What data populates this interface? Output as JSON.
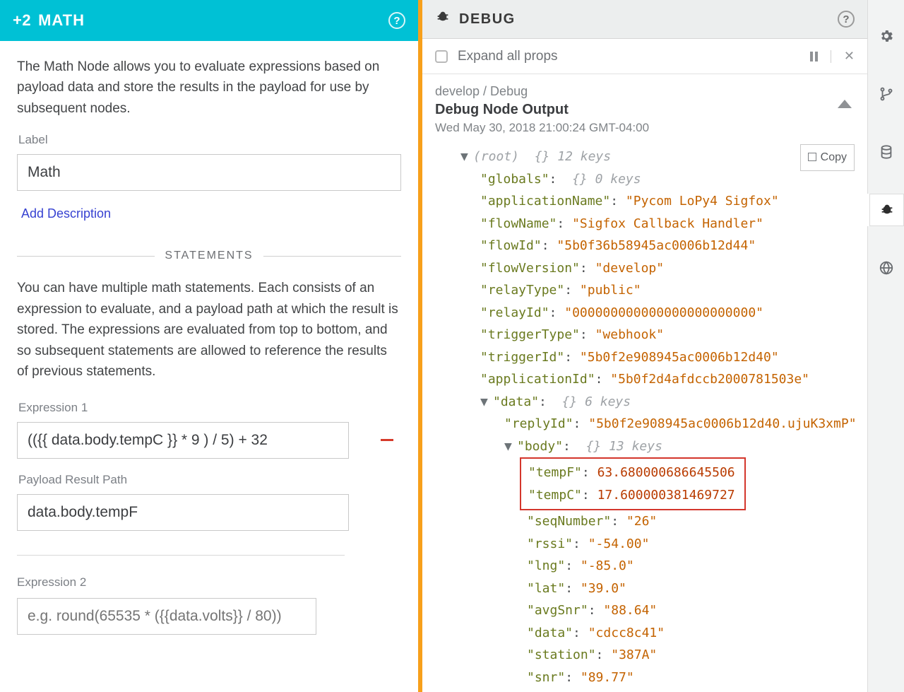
{
  "leftPanel": {
    "header": {
      "badge": "+2",
      "title": "MATH"
    },
    "intro": "The Math Node allows you to evaluate expressions based on payload data and store the results in the payload for use by subsequent nodes.",
    "labelField": {
      "label": "Label",
      "value": "Math"
    },
    "addDescription": "Add Description",
    "statementsHeader": "STATEMENTS",
    "statementsText": "You can have multiple math statements. Each consists of an expression to evaluate, and a payload path at which the result is stored. The expressions are evaluated from top to bottom, and so subsequent statements are allowed to reference the results of previous statements.",
    "expr1": {
      "label": "Expression 1",
      "value": "(({{ data.body.tempC }} * 9 ) / 5) + 32"
    },
    "resultPath": {
      "label": "Payload Result Path",
      "value": "data.body.tempF"
    },
    "expr2": {
      "label": "Expression 2",
      "placeholder": "e.g. round(65535 * ({{data.volts}} / 80))"
    }
  },
  "rightPanel": {
    "headerTitle": "DEBUG",
    "expandAll": "Expand all props",
    "crumbs": "develop / Debug",
    "title": "Debug Node Output",
    "timestamp": "Wed May 30, 2018 21:00:24 GMT-04:00",
    "copyLabel": "Copy",
    "root": {
      "label": "(root)",
      "meta": "{}  12 keys"
    },
    "rows": [
      {
        "key": "globals",
        "metaOnly": true,
        "meta": "{}  0 keys"
      },
      {
        "key": "applicationName",
        "val": "Pycom LoPy4 Sigfox",
        "type": "str"
      },
      {
        "key": "flowName",
        "val": "Sigfox Callback Handler",
        "type": "str"
      },
      {
        "key": "flowId",
        "val": "5b0f36b58945ac0006b12d44",
        "type": "str"
      },
      {
        "key": "flowVersion",
        "val": "develop",
        "type": "str"
      },
      {
        "key": "relayType",
        "val": "public",
        "type": "str"
      },
      {
        "key": "relayId",
        "val": "000000000000000000000000",
        "type": "str"
      },
      {
        "key": "triggerType",
        "val": "webhook",
        "type": "str"
      },
      {
        "key": "triggerId",
        "val": "5b0f2e908945ac0006b12d40",
        "type": "str"
      },
      {
        "key": "applicationId",
        "val": "5b0f2d4afdccb2000781503e",
        "type": "str"
      }
    ],
    "dataNode": {
      "key": "data",
      "meta": "{}  6 keys"
    },
    "replyRow": {
      "key": "replyId",
      "val": "5b0f2e908945ac0006b12d40.ujuK3xmP",
      "type": "str"
    },
    "bodyNode": {
      "key": "body",
      "meta": "{}  13 keys"
    },
    "highlight": [
      {
        "key": "tempF",
        "val": "63.680000686645506"
      },
      {
        "key": "tempC",
        "val": "17.600000381469727"
      }
    ],
    "bodyRows": [
      {
        "key": "seqNumber",
        "val": "26"
      },
      {
        "key": "rssi",
        "val": "-54.00"
      },
      {
        "key": "lng",
        "val": "-85.0"
      },
      {
        "key": "lat",
        "val": "39.0"
      },
      {
        "key": "avgSnr",
        "val": "88.64"
      },
      {
        "key": "data",
        "val": "cdcc8c41"
      },
      {
        "key": "station",
        "val": "387A"
      },
      {
        "key": "snr",
        "val": "89.77"
      }
    ]
  }
}
